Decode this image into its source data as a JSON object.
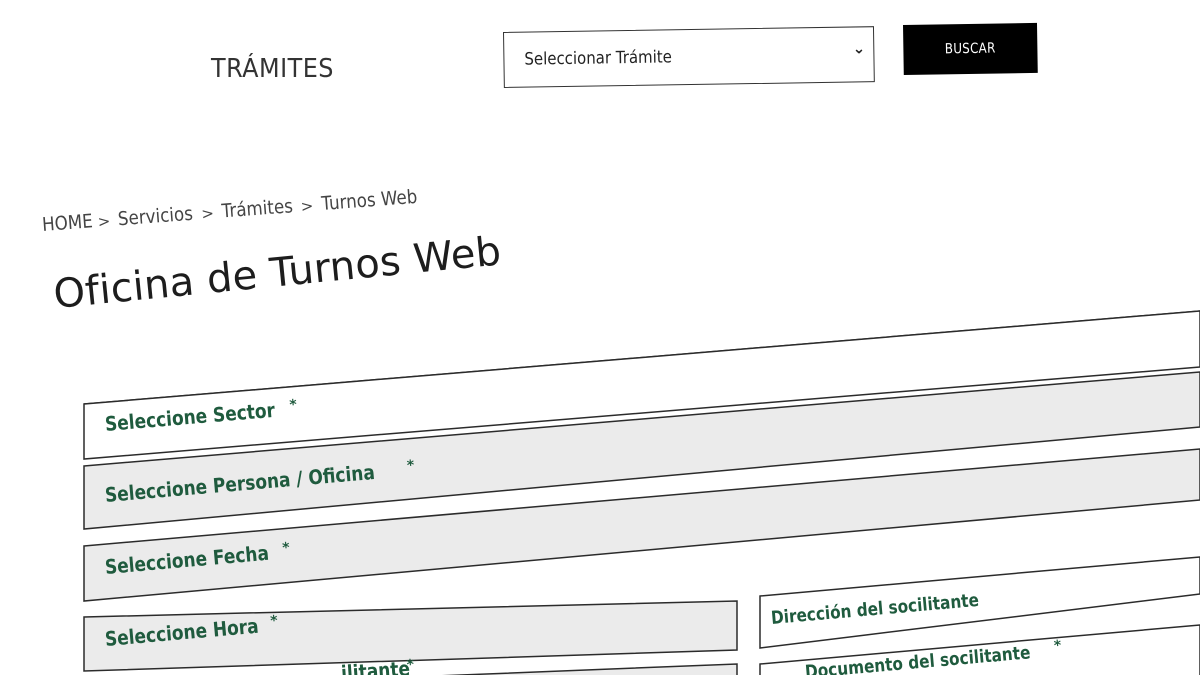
{
  "header": {
    "title": "TRÁMITES",
    "tramite_select": {
      "selected": "Seleccionar Trámite"
    },
    "search_button": "BUSCAR"
  },
  "breadcrumb": {
    "items": [
      "HOME",
      "Servicios",
      "Trámites",
      "Turnos Web"
    ],
    "separator": ">"
  },
  "page_title": "Oficina de Turnos Web",
  "form": {
    "required_mark": "*",
    "sector": "Seleccione Sector",
    "persona_oficina": "Seleccione Persona / Oficina",
    "fecha": "Seleccione Fecha",
    "hora": "Seleccione Hora",
    "direccion": "Dirección  del socilitante",
    "documento": "Documento del socilitante",
    "partial_left": "ilitante"
  },
  "colors": {
    "label_green": "#1f5b3e",
    "button_bg": "#000000",
    "shaded_row": "#ebebeb"
  }
}
